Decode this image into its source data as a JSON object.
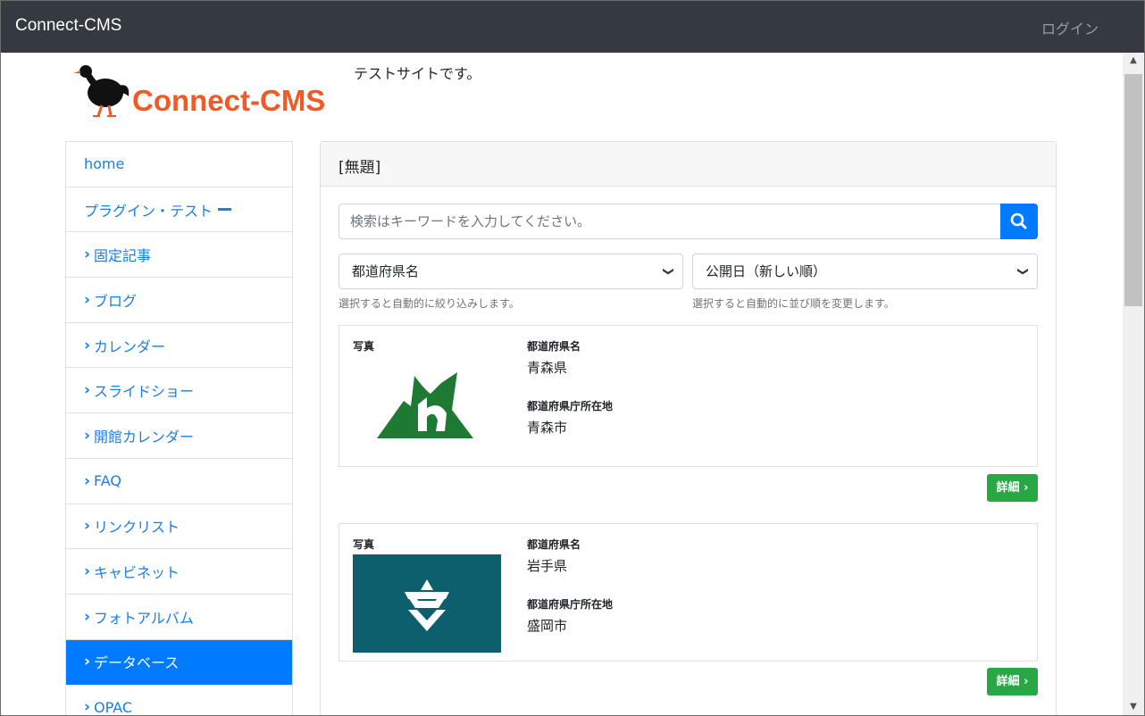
{
  "navbar": {
    "brand": "Connect-CMS",
    "login": "ログイン"
  },
  "header": {
    "logo_text": "Connect-CMS",
    "tagline": "テストサイトです。"
  },
  "sidebar": {
    "items": [
      {
        "label": "home",
        "prefix": "",
        "active": false
      },
      {
        "label": "プラグイン・テスト",
        "prefix": "",
        "active": false
      },
      {
        "label": "固定記事",
        "prefix": "›",
        "active": false
      },
      {
        "label": "ブログ",
        "prefix": "›",
        "active": false
      },
      {
        "label": "カレンダー",
        "prefix": "›",
        "active": false
      },
      {
        "label": "スライドショー",
        "prefix": "›",
        "active": false
      },
      {
        "label": "開館カレンダー",
        "prefix": "›",
        "active": false
      },
      {
        "label": "FAQ",
        "prefix": "›",
        "active": false
      },
      {
        "label": "リンクリスト",
        "prefix": "›",
        "active": false
      },
      {
        "label": "キャビネット",
        "prefix": "›",
        "active": false
      },
      {
        "label": "フォトアルバム",
        "prefix": "›",
        "active": false
      },
      {
        "label": "データベース",
        "prefix": "›",
        "active": true
      },
      {
        "label": "OPAC",
        "prefix": "›",
        "active": false
      }
    ]
  },
  "panel": {
    "title": "[無題]",
    "search_placeholder": "検索はキーワードを入力してください。",
    "filter_select": "都道府県名",
    "filter_hint": "選択すると自動的に絞り込みします。",
    "sort_select": "公開日（新しい順）",
    "sort_hint": "選択すると自動的に並び順を変更します。"
  },
  "records": [
    {
      "photo_label": "写真",
      "pref_label": "都道府県名",
      "pref": "青森県",
      "capital_label": "都道府県庁所在地",
      "capital": "青森市",
      "detail": "詳細"
    },
    {
      "photo_label": "写真",
      "pref_label": "都道府県名",
      "pref": "岩手県",
      "capital_label": "都道府県庁所在地",
      "capital": "盛岡市",
      "detail": "詳細"
    }
  ],
  "colors": {
    "navbar": "#343a40",
    "primary": "#007bff",
    "success": "#28a745",
    "logo": "#f15a24",
    "aomori_green": "#1e7a32",
    "iwate_teal": "#0e5f6e"
  }
}
